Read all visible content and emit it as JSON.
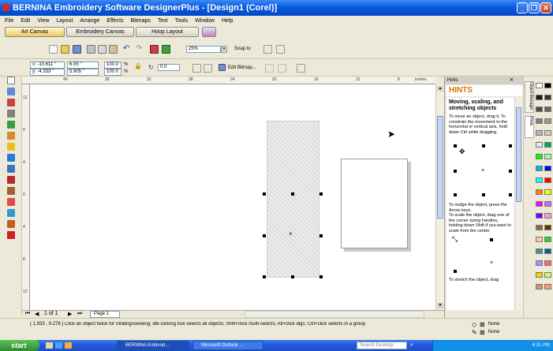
{
  "window": {
    "title": "BERNINA Embroidery Software DesignerPlus - [Design1 (Corel)]",
    "controls": [
      "minimize",
      "restore",
      "close"
    ]
  },
  "menu": [
    "File",
    "Edit",
    "View",
    "Layout",
    "Arrange",
    "Effects",
    "Bitmaps",
    "Text",
    "Tools",
    "Window",
    "Help"
  ],
  "tabs": [
    {
      "label": "Art Canvas",
      "active": true
    },
    {
      "label": "Embroidery Canvas",
      "active": false
    },
    {
      "label": "Hoop Layout",
      "active": false
    }
  ],
  "toolbar": {
    "zoom": "25%",
    "snap_to": "Snap to"
  },
  "property_bar": {
    "x": "x: -10.611 \"",
    "y": "y: -4.333 \"",
    "width": "6.05 \"",
    "height": "5.905 \"",
    "scale_x": "100.0",
    "scale_y": "100.0",
    "percent": "%",
    "rotation": "0.0",
    "edit_bitmap": "Edit Bitmap..."
  },
  "ruler": {
    "unit": "inches",
    "h_ticks": [
      "40",
      "36",
      "32",
      "28",
      "24",
      "20",
      "16",
      "12",
      "8"
    ],
    "v_ticks": [
      "12",
      "8",
      "4",
      "0",
      "4",
      "8",
      "12"
    ]
  },
  "page_nav": {
    "position": "1 of 1",
    "page_tab": "Page 1"
  },
  "hints": {
    "panel_title": "Hints",
    "heading": "HINTS",
    "topic": "Moving, scaling, and stretching objects",
    "bullets": [
      "To move an object, drag it. To constrain the movement to the horizontal or vertical axis, hold down Ctrl while dragging.",
      "To nudge the object, press the Arrow keys.",
      "To scale the object, drag one of the corner sizing handles, holding down Shift if you want to scale from the center.",
      "To stretch the object, drag"
    ]
  },
  "docker_tabs": [
    "Object Manager",
    "Hints"
  ],
  "status": {
    "coords": "( 1.833 , 9.278 )",
    "message": "Click an object twice for rotating/skewing; dbl-clicking tool selects all objects; Shift+click multi-selects; Alt+click digs; Ctrl+click selects in a group",
    "fill": "None",
    "outline": "None"
  },
  "taskbar": {
    "start": "start",
    "tasks": [
      "BERNINA Embroid...",
      "Microsoft Outlook ..."
    ],
    "search_placeholder": "Search Desktop",
    "clock": "4:31 PM"
  },
  "colors": {
    "title_blue": "#0a5be0",
    "hint_orange": "#e07000",
    "taskbar_blue": "#2358d8",
    "start_green": "#2e8b2e"
  },
  "palette": [
    "#ffffff",
    "#000000",
    "#1a1a1a",
    "#333333",
    "#4d4d4d",
    "#666666",
    "#808080",
    "#999999",
    "#b3b3b3",
    "#cccccc",
    "#e6e6e6",
    "#00a650",
    "#00ff00",
    "#9cff9c",
    "#00b7eb",
    "#0000ff",
    "#00ffff",
    "#ff0000",
    "#ff7f00",
    "#ffff00",
    "#ff00ff",
    "#cc66ff",
    "#7f00ff",
    "#ff99cc",
    "#996633",
    "#663300",
    "#ffcc99",
    "#33cc33",
    "#339999",
    "#006699",
    "#9999ff",
    "#ff6666",
    "#ffcc00",
    "#ccff66",
    "#cc9966",
    "#ff9966"
  ]
}
